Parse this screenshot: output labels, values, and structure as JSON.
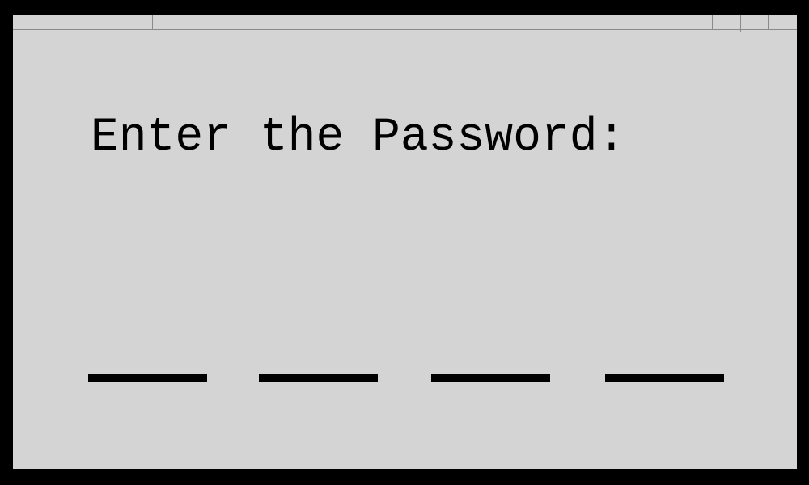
{
  "window": {
    "tabs": [
      {
        "label": ""
      },
      {
        "label": ""
      },
      {
        "label": ""
      }
    ],
    "controls": [
      "minimize-icon",
      "maximize-icon",
      "close-icon"
    ]
  },
  "prompt": {
    "text": "Enter the Password:"
  },
  "password": {
    "length": 4,
    "digits": [
      "",
      "",
      "",
      ""
    ]
  },
  "colors": {
    "background": "#000000",
    "panel": "#d4d4d4",
    "text": "#000000",
    "divider": "#8a8a8a"
  }
}
